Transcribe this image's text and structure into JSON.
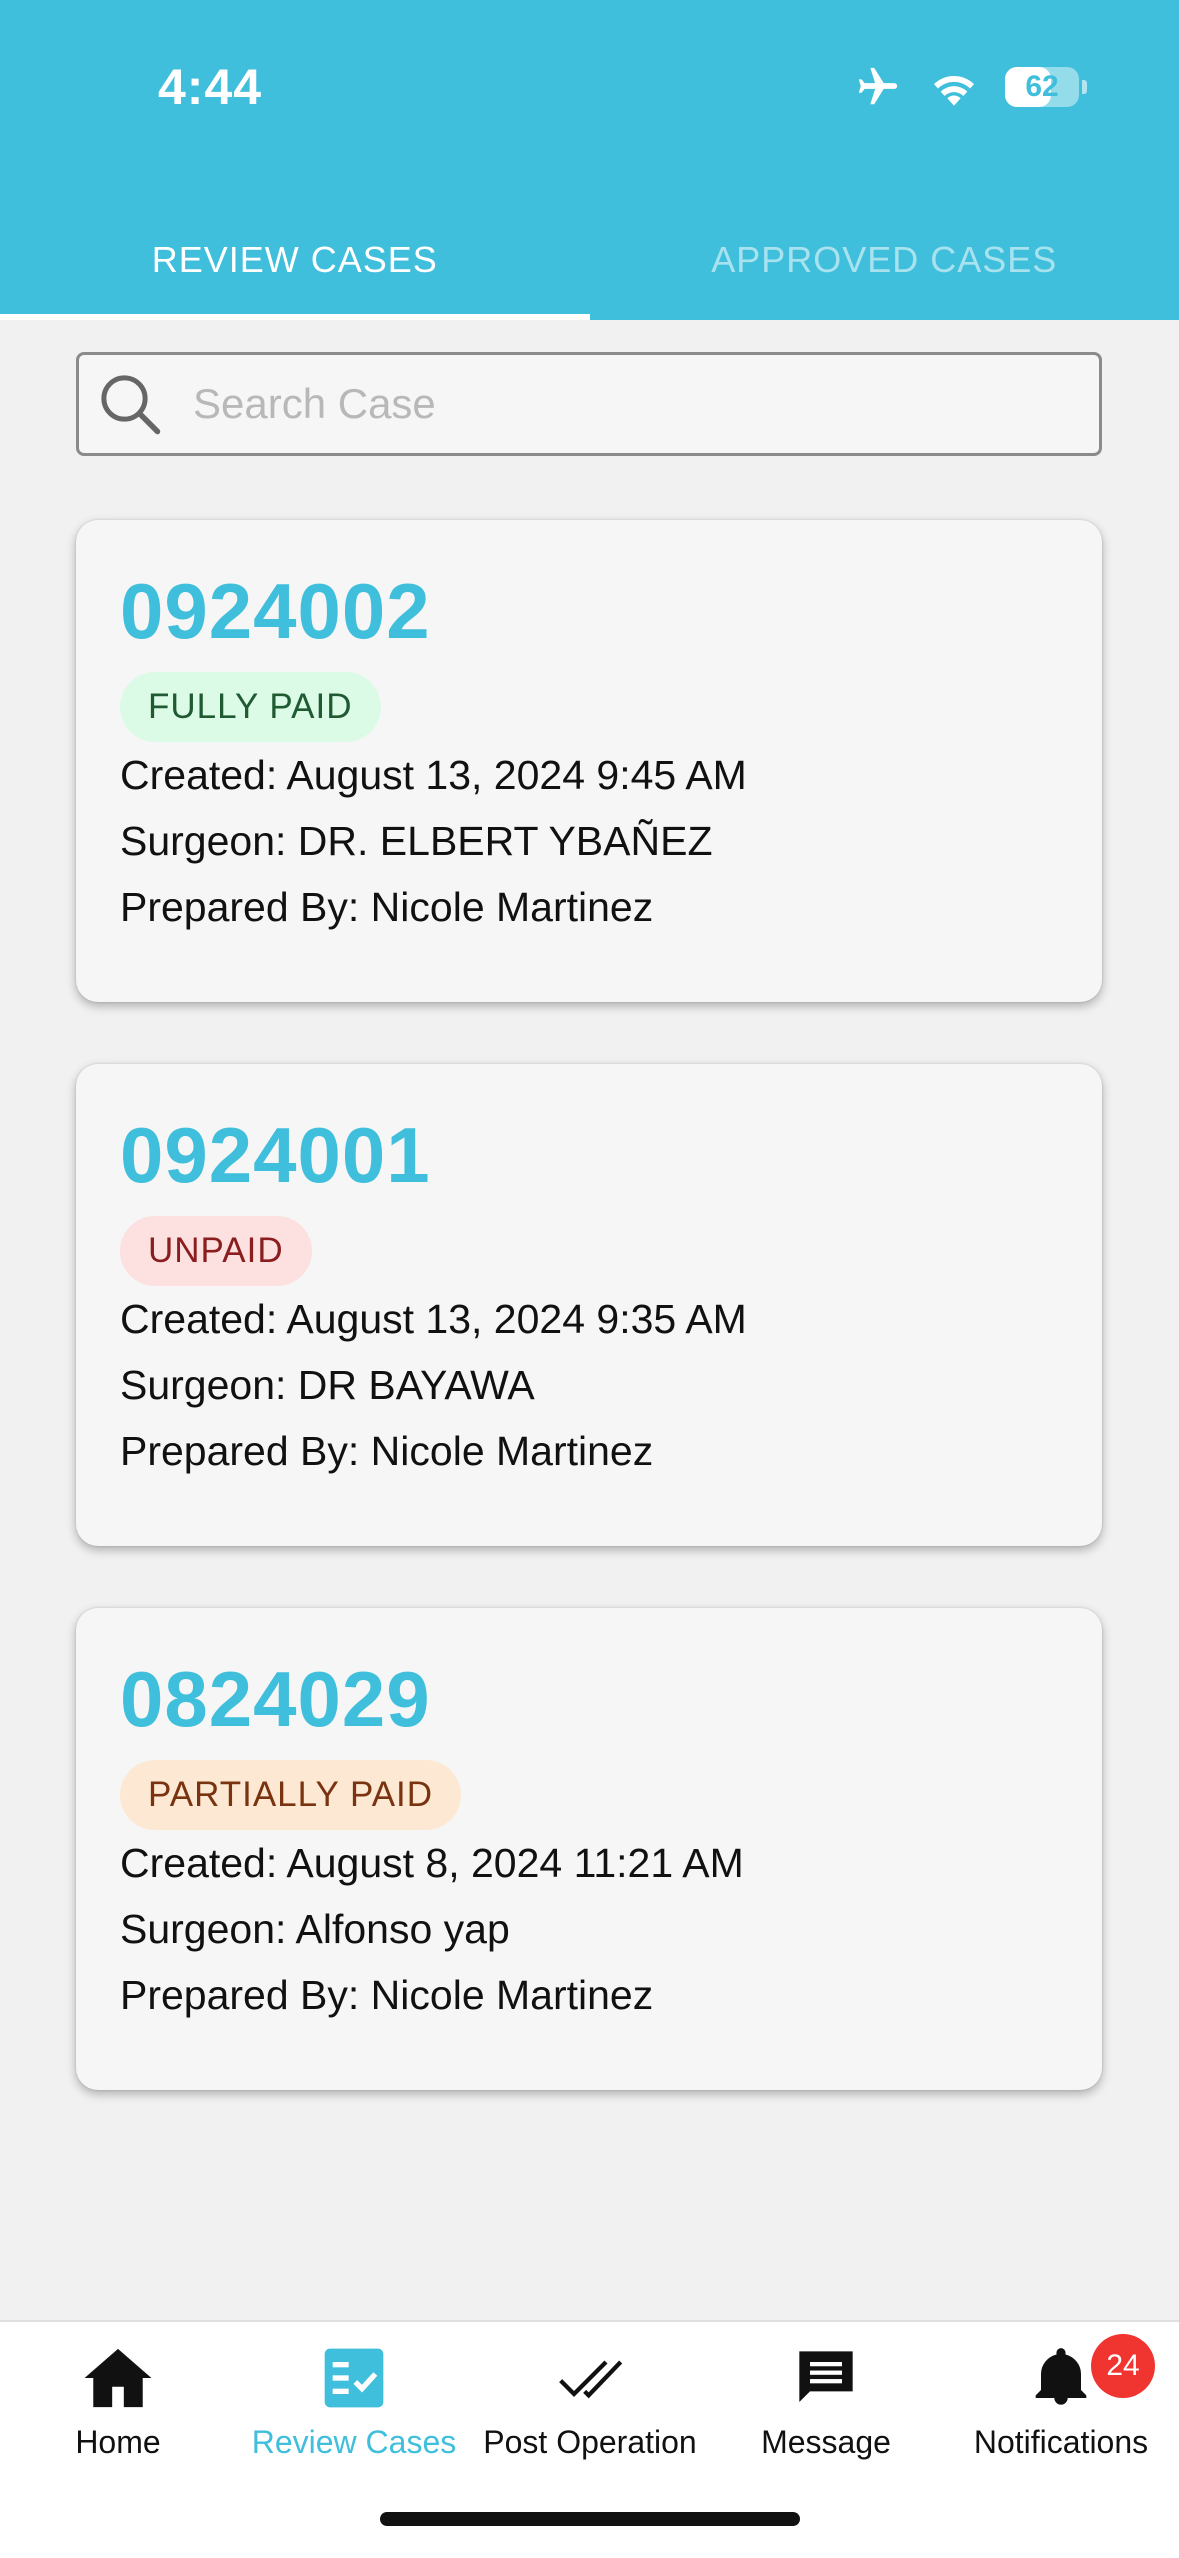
{
  "status_bar": {
    "time": "4:44",
    "battery": "62",
    "battery_level": 0.62
  },
  "tabs": [
    {
      "label": "REVIEW CASES",
      "active": true
    },
    {
      "label": "APPROVED CASES",
      "active": false
    }
  ],
  "search": {
    "placeholder": "Search Case",
    "value": ""
  },
  "cases": [
    {
      "number": "0924002",
      "status": "FULLY PAID",
      "created": "Created: August 13, 2024 9:45 AM",
      "surgeon": "Surgeon: DR. ELBERT YBAÑEZ",
      "prepared_by": "Prepared By: Nicole Martinez"
    },
    {
      "number": "0924001",
      "status": "UNPAID",
      "created": "Created: August 13, 2024 9:35 AM",
      "surgeon": "Surgeon: DR BAYAWA",
      "prepared_by": "Prepared By: Nicole Martinez"
    },
    {
      "number": "0824029",
      "status": "PARTIALLY PAID",
      "created": "Created: August 8, 2024 11:21 AM",
      "surgeon": "Surgeon: Alfonso yap",
      "prepared_by": "Prepared By: Nicole Martinez"
    }
  ],
  "colors": {
    "accent": "#3fbfdb",
    "badge_red": "#f0342f"
  },
  "bottom_nav": [
    {
      "label": "Home",
      "icon": "home-icon"
    },
    {
      "label": "Review Cases",
      "icon": "review-cases-icon",
      "active": true
    },
    {
      "label": "Post Operation",
      "icon": "double-check-icon"
    },
    {
      "label": "Message",
      "icon": "message-icon"
    },
    {
      "label": "Notifications",
      "icon": "bell-icon",
      "badge": "24"
    }
  ]
}
